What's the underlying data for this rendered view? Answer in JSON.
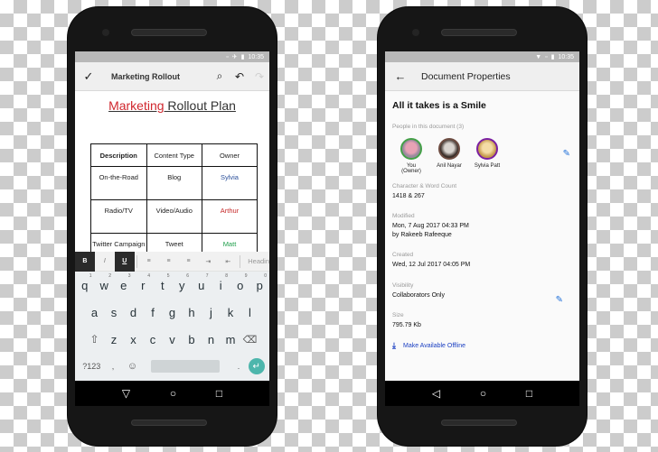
{
  "status_bar": {
    "time": "10:35"
  },
  "left_phone": {
    "app_bar": {
      "done_icon": "check-icon",
      "title": "Marketing Rollout",
      "search_icon": "search-icon",
      "undo_icon": "undo-icon",
      "redo_icon": "redo-icon"
    },
    "document": {
      "heading_red": "Marketing",
      "heading_rest": " Rollout Plan",
      "table": {
        "headers": [
          "Description",
          "Content Type",
          "Owner"
        ],
        "rows": [
          [
            "On-the-Road",
            "Blog",
            "Sylvia"
          ],
          [
            "Radio/TV",
            "Video/Audio",
            "Arthur"
          ],
          [
            "Twitter Campaign",
            "Tweet",
            "Matt"
          ]
        ],
        "owner_colors": [
          "#2a4f9a",
          "#c62828",
          "#1e9e4a"
        ]
      }
    },
    "format_bar": {
      "bold": "B",
      "italic": "I",
      "underline": "U",
      "heading": "Headin"
    },
    "keyboard": {
      "row1": [
        "q",
        "w",
        "e",
        "r",
        "t",
        "y",
        "u",
        "i",
        "o",
        "p"
      ],
      "row1_hints": [
        "1",
        "2",
        "3",
        "4",
        "5",
        "6",
        "7",
        "8",
        "9",
        "0"
      ],
      "row2": [
        "a",
        "s",
        "d",
        "f",
        "g",
        "h",
        "j",
        "k",
        "l"
      ],
      "row3": [
        "z",
        "x",
        "c",
        "v",
        "b",
        "n",
        "m"
      ],
      "symbols_key": "?123",
      "comma_key": ",",
      "period_key": "."
    }
  },
  "right_phone": {
    "app_bar": {
      "title": "Document Properties"
    },
    "doc_name": "All it takes is a Smile",
    "people_label": "People in this document (3)",
    "people": [
      {
        "name": "You",
        "sub": "(Owner)"
      },
      {
        "name": "Anil Nayar",
        "sub": ""
      },
      {
        "name": "Sylvia Patt",
        "sub": ""
      }
    ],
    "char_word_label": "Character & Word Count",
    "char_word_value": "1418 & 267",
    "modified_label": "Modified",
    "modified_value": "Mon, 7 Aug 2017 04:33 PM",
    "modified_by": "by Rakeeb Rafeeque",
    "created_label": "Created",
    "created_value": "Wed, 12 Jul 2017 04:05 PM",
    "visibility_label": "Visibility",
    "visibility_value": "Collaborators Only",
    "size_label": "Size",
    "size_value": "795.79 Kb",
    "offline_action": "Make Available Offline"
  },
  "nav": {
    "back": "▽",
    "home": "○",
    "recents": "□"
  }
}
